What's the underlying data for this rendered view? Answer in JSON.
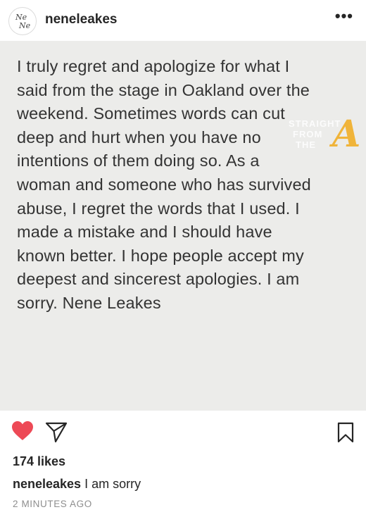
{
  "header": {
    "username": "neneleakes",
    "avatar_text": "Ne Ne",
    "more_label": "•••"
  },
  "post": {
    "lines": [
      "I truly regret and apologize for what I",
      "said from the stage in Oakland over the",
      "weekend. Sometimes words can cut",
      "deep and hurt when you have no",
      "intentions of them doing so. As a",
      "woman and someone who has survived",
      "abuse, I regret the words that I used. I",
      "made a mistake and I should have",
      "known better. I hope people accept my",
      "deepest and sincerest apologies. I am",
      "sorry. Nene Leakes"
    ],
    "watermark": {
      "line1": "STRAIGHT",
      "line2": "FROM",
      "line3": "THE",
      "letter": "A"
    }
  },
  "actions": {
    "like_icon": "heart-icon",
    "share_icon": "paper-plane-icon",
    "save_icon": "bookmark-icon",
    "like_color": "#ed4956"
  },
  "likes_text": "174 likes",
  "caption": {
    "username": "neneleakes",
    "text": "I am sorry"
  },
  "timestamp": "2 MINUTES AGO"
}
